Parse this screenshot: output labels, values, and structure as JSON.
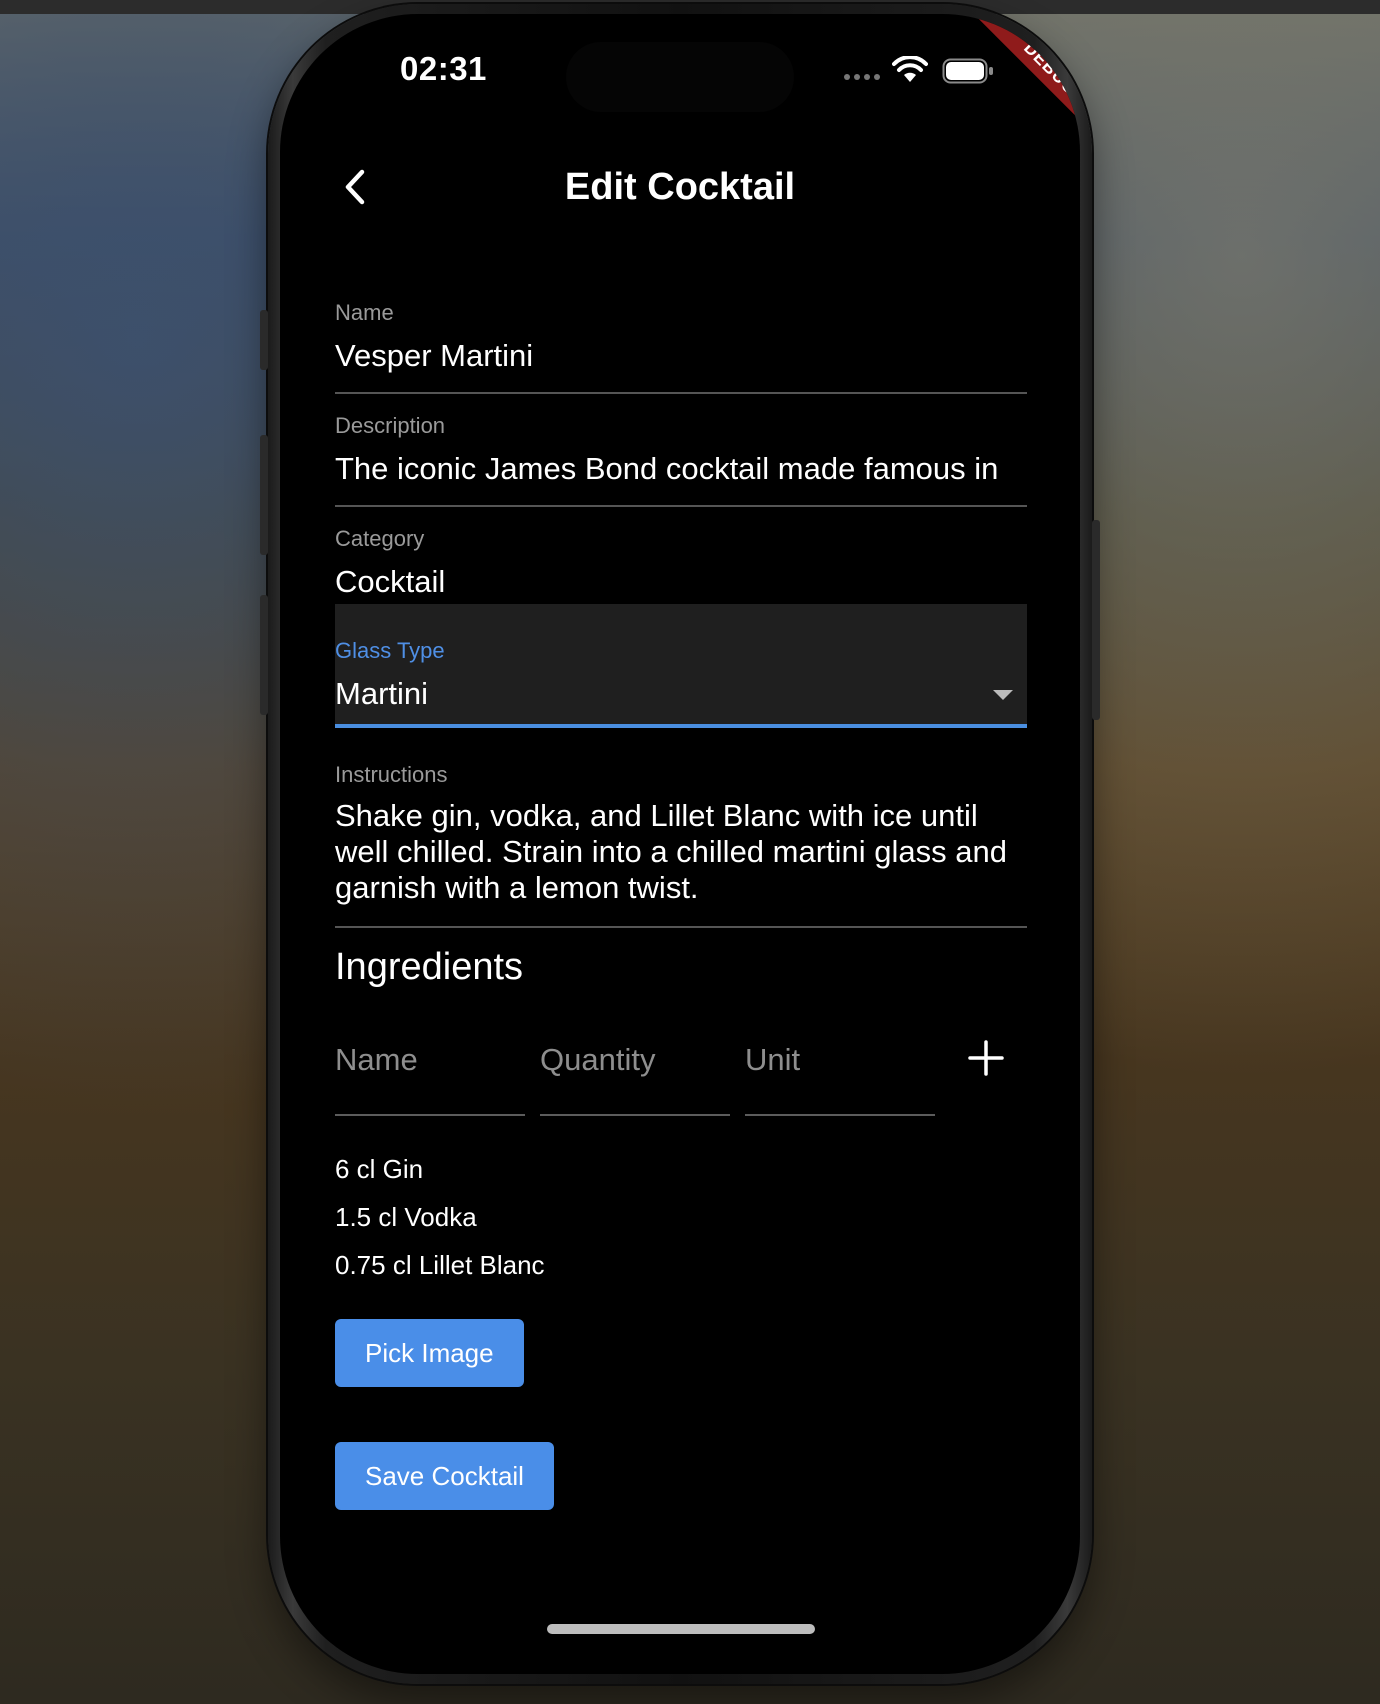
{
  "status_bar": {
    "time": "02:31",
    "debug_banner": "DEBUG"
  },
  "header": {
    "title": "Edit Cocktail"
  },
  "form": {
    "name": {
      "label": "Name",
      "value": "Vesper Martini"
    },
    "description": {
      "label": "Description",
      "value": "The iconic James Bond cocktail made famous in"
    },
    "category": {
      "label": "Category",
      "value": "Cocktail"
    },
    "glass_type": {
      "label": "Glass Type",
      "value": "Martini"
    },
    "instructions": {
      "label": "Instructions",
      "value": "Shake gin, vodka, and Lillet Blanc with ice until well chilled. Strain into a chilled martini glass and garnish with a lemon twist."
    }
  },
  "ingredients": {
    "title": "Ingredients",
    "name_placeholder": "Name",
    "quantity_placeholder": "Quantity",
    "unit_placeholder": "Unit",
    "items": [
      "6 cl Gin",
      "1.5 cl Vodka",
      "0.75 cl Lillet Blanc"
    ]
  },
  "buttons": {
    "pick_image": "Pick Image",
    "save_cocktail": "Save Cocktail"
  },
  "colors": {
    "accent": "#4a8ee8",
    "background": "#000000",
    "debug_banner": "#8f1b1b"
  }
}
